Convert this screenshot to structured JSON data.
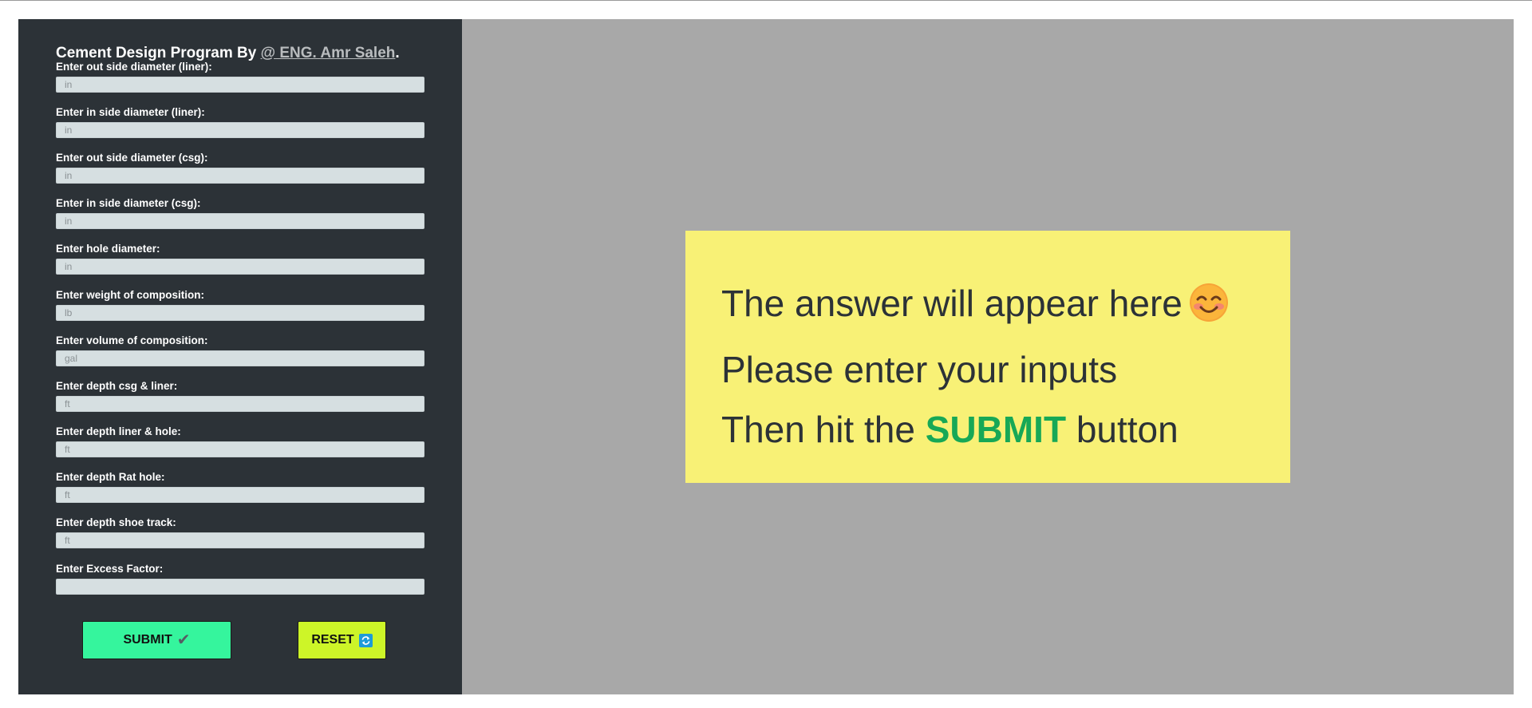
{
  "header": {
    "title_prefix": "Cement Design Program By ",
    "author": "@ ENG. Amr Saleh",
    "title_suffix": "."
  },
  "form": {
    "fields": [
      {
        "label": "Enter out side diameter (liner):",
        "placeholder": "in"
      },
      {
        "label": "Enter in side diameter (liner):",
        "placeholder": "in"
      },
      {
        "label": "Enter out side diameter (csg):",
        "placeholder": "in"
      },
      {
        "label": "Enter in side diameter (csg):",
        "placeholder": "in"
      },
      {
        "label": "Enter hole diameter:",
        "placeholder": "in"
      },
      {
        "label": "Enter weight of composition:",
        "placeholder": "lb"
      },
      {
        "label": "Enter volume of composition:",
        "placeholder": "gal"
      },
      {
        "label": "Enter depth csg & liner:",
        "placeholder": "ft"
      },
      {
        "label": "Enter depth liner & hole:",
        "placeholder": "ft"
      },
      {
        "label": "Enter depth Rat hole:",
        "placeholder": "ft"
      },
      {
        "label": "Enter depth shoe track:",
        "placeholder": "ft"
      },
      {
        "label": "Enter Excess Factor:",
        "placeholder": ""
      }
    ],
    "submit_label": "SUBMIT",
    "reset_label": "RESET"
  },
  "answer": {
    "line1": "The answer will appear here",
    "line2": "Please enter your inputs",
    "line3_prefix": "Then hit the ",
    "line3_highlight": "SUBMIT",
    "line3_suffix": " button"
  },
  "icons": {
    "submit": "check-icon",
    "reset": "refresh-icon",
    "answer": "smiling-face-icon"
  },
  "colors": {
    "sidebar_bg": "#2c3237",
    "main_bg": "#a8a8a8",
    "answer_bg": "#f8f176",
    "submit_btn": "#35f59d",
    "reset_btn": "#cdf528",
    "highlight": "#17a856"
  }
}
